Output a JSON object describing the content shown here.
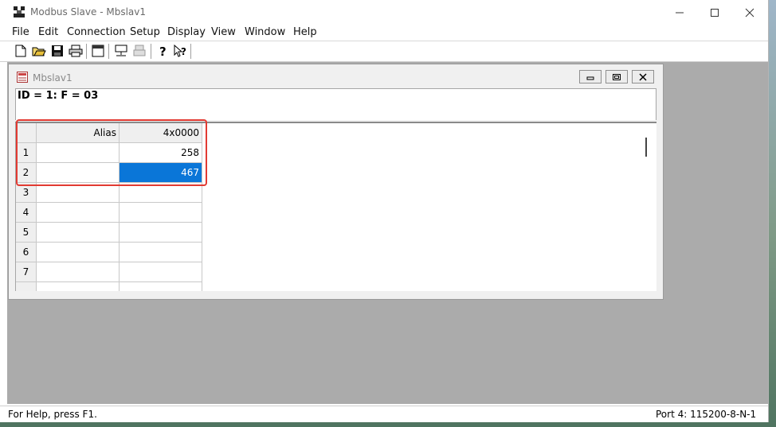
{
  "app": {
    "title": "Modbus Slave - Mbslav1"
  },
  "menu": [
    "File",
    "Edit",
    "Connection",
    "Setup",
    "Display",
    "View",
    "Window",
    "Help"
  ],
  "toolbar": {
    "buttons": [
      "new-file-icon",
      "open-folder-icon",
      "save-icon",
      "print-icon",
      "window-icon",
      "connect-icon",
      "disconnect-icon",
      "help-icon",
      "context-help-icon"
    ]
  },
  "child_window": {
    "title": "Mbslav1",
    "id_line": "ID = 1: F = 03",
    "grid": {
      "headers": [
        "Alias",
        "4x0000"
      ],
      "rows": [
        {
          "num": "1",
          "alias": "",
          "value": "258"
        },
        {
          "num": "2",
          "alias": "",
          "value": "467"
        },
        {
          "num": "3",
          "alias": "",
          "value": ""
        },
        {
          "num": "4",
          "alias": "",
          "value": ""
        },
        {
          "num": "5",
          "alias": "",
          "value": ""
        },
        {
          "num": "6",
          "alias": "",
          "value": ""
        },
        {
          "num": "7",
          "alias": "",
          "value": ""
        }
      ],
      "selected_row": 2
    }
  },
  "status": {
    "left": "For Help, press F1.",
    "right": "Port 4: 115200-8-N-1"
  },
  "colors": {
    "selection": "#0a76d8",
    "highlight_box": "#e23a32",
    "workspace": "#ababab"
  }
}
